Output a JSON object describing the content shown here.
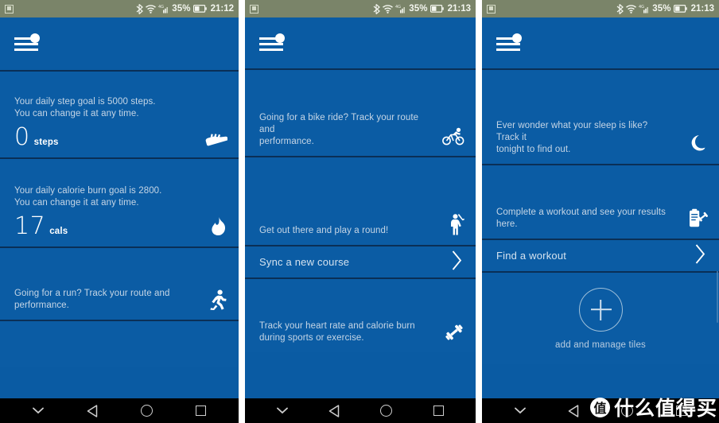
{
  "colors": {
    "tile_blue": "#0b5ca4",
    "app_bar_blue": "#0a5ba3",
    "divider_navy": "#0a2f56",
    "status_bar": "#7a8469",
    "nav_bar": "#000000",
    "desc_text": "#c6d6e6",
    "value_text": "#ffffff"
  },
  "screens": [
    {
      "id": "screen-steps-calories",
      "status_bar": {
        "notification_icon": "screenshot-icon",
        "bluetooth_icon": "bluetooth-icon",
        "wifi_icon": "wifi-icon",
        "signal_icon": "signal-icon",
        "network_label": "4G",
        "battery_percent": "35%",
        "battery_icon": "battery-icon",
        "time": "21:12"
      },
      "app_bar": {
        "menu_icon": "hamburger-menu-icon"
      },
      "tiles": [
        {
          "name": "steps-tile",
          "desc_line1": "Your daily step goal is 5000 steps.",
          "desc_line2": "You can change it at any time.",
          "value": "0",
          "unit": "steps",
          "icon": "running-shoe-icon"
        },
        {
          "name": "calories-tile",
          "desc_line1": "Your daily calorie burn goal is 2800.",
          "desc_line2": "You can change it at any time.",
          "value": "17",
          "unit": "cals",
          "icon": "flame-icon"
        },
        {
          "name": "run-tile",
          "desc_line1": "Going for a run? Track your route and",
          "desc_line2": "performance.",
          "icon": "running-person-icon"
        }
      ],
      "nav_bar": {
        "hide_icon": "chevron-down-icon",
        "back_icon": "back-triangle-icon",
        "home_icon": "home-circle-icon",
        "recents_icon": "recents-square-icon"
      }
    },
    {
      "id": "screen-bike-golf-exercise",
      "status_bar": {
        "notification_icon": "screenshot-icon",
        "bluetooth_icon": "bluetooth-icon",
        "wifi_icon": "wifi-icon",
        "signal_icon": "signal-icon",
        "network_label": "4G",
        "battery_percent": "35%",
        "battery_icon": "battery-icon",
        "time": "21:13"
      },
      "app_bar": {
        "menu_icon": "hamburger-menu-icon"
      },
      "tiles": [
        {
          "name": "bike-tile",
          "desc_line1": "Going for a bike ride? Track your route and",
          "desc_line2": "performance.",
          "icon": "bicycle-icon"
        },
        {
          "name": "golf-tile",
          "desc_line1": "Get out there and play a round!",
          "desc_line2": "",
          "icon": "golfer-icon"
        },
        {
          "name": "sync-course-row",
          "link_label": "Sync a new course",
          "icon": "chevron-right-icon"
        },
        {
          "name": "exercise-tile",
          "desc_line1": "Track your heart rate and calorie burn",
          "desc_line2": "during sports or exercise.",
          "icon": "dumbbell-icon"
        }
      ],
      "nav_bar": {
        "hide_icon": "chevron-down-icon",
        "back_icon": "back-triangle-icon",
        "home_icon": "home-circle-icon",
        "recents_icon": "recents-square-icon"
      }
    },
    {
      "id": "screen-sleep-workout-add",
      "status_bar": {
        "notification_icon": "screenshot-icon",
        "bluetooth_icon": "bluetooth-icon",
        "wifi_icon": "wifi-icon",
        "signal_icon": "signal-icon",
        "network_label": "4G",
        "battery_percent": "35%",
        "battery_icon": "battery-icon",
        "time": "21:13"
      },
      "app_bar": {
        "menu_icon": "hamburger-menu-icon"
      },
      "tiles": [
        {
          "name": "sleep-tile",
          "desc_line1": "Ever wonder what your sleep is like? Track it",
          "desc_line2": "tonight to find out.",
          "icon": "crescent-moon-icon"
        },
        {
          "name": "workout-tile",
          "desc_line1": "Complete a workout and see your results",
          "desc_line2": "here.",
          "icon": "clipboard-workout-icon"
        },
        {
          "name": "find-workout-row",
          "link_label": "Find a workout",
          "icon": "chevron-right-icon"
        }
      ],
      "add_tiles": {
        "icon": "plus-circle-icon",
        "label": "add and manage tiles"
      },
      "nav_bar": {
        "hide_icon": "chevron-down-icon",
        "back_icon": "back-triangle-icon",
        "home_icon": "home-circle-icon",
        "recents_icon": "recents-square-icon"
      }
    }
  ],
  "watermark": {
    "badge": "值",
    "text": "什么值得买"
  }
}
